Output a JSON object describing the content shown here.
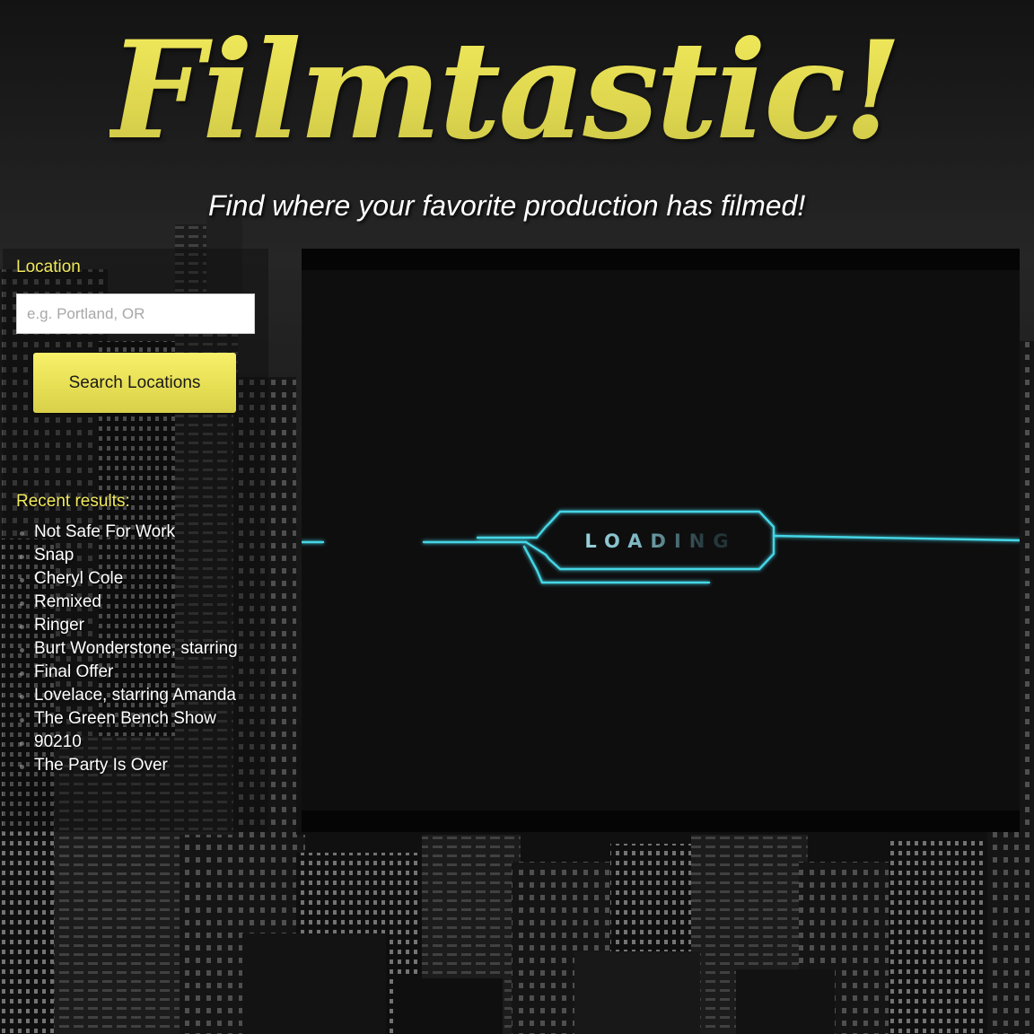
{
  "app": {
    "title": "Filmtastic!",
    "tagline": "Find where your favorite production has filmed!"
  },
  "search": {
    "label": "Location",
    "placeholder": "e.g. Portland, OR",
    "value": "",
    "button_label": "Search Locations"
  },
  "recent": {
    "heading": "Recent results:",
    "items": [
      "Not Safe For Work",
      "Snap",
      "Cheryl Cole",
      "Remixed",
      "Ringer",
      "Burt Wonderstone, starring",
      "Final Offer",
      "Lovelace, starring Amanda",
      "The Green Bench Show",
      "90210",
      "The Party Is Over"
    ]
  },
  "map": {
    "loading_text": "LOADING"
  },
  "colors": {
    "accent": "#f2ea5c",
    "loader_glow": "#3fd0e0",
    "panel": "#0e0e0f"
  }
}
